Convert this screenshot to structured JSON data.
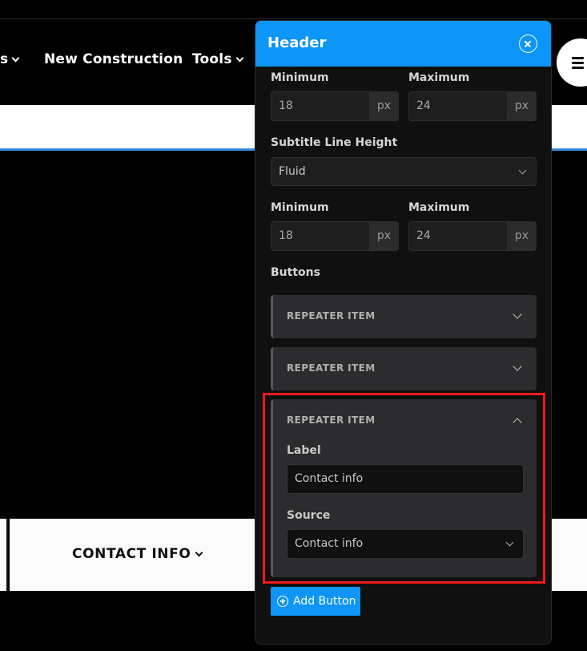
{
  "site": {
    "nav": [
      {
        "label": "s",
        "icon": "chevron-down-icon"
      },
      {
        "label": "New Construction"
      },
      {
        "label": "Tools",
        "icon": "chevron-down-icon"
      }
    ],
    "contact_menu": {
      "label": "CONTACT INFO",
      "icon": "chevron-down-icon"
    },
    "menu_icon": "hamburger-icon"
  },
  "panel": {
    "title": "Header",
    "close_icon": "close-circle-icon",
    "title_font_size": {
      "min_label": "Minimum",
      "min_value": "18",
      "min_unit": "px",
      "max_label": "Maximum",
      "max_value": "24",
      "max_unit": "px"
    },
    "subtitle_line_height": {
      "label": "Subtitle Line Height",
      "selected": "Fluid",
      "min_label": "Minimum",
      "min_value": "18",
      "min_unit": "px",
      "max_label": "Maximum",
      "max_value": "24",
      "max_unit": "px"
    },
    "buttons": {
      "label": "Buttons",
      "items": [
        {
          "title": "REPEATER ITEM",
          "expanded": false
        },
        {
          "title": "REPEATER ITEM",
          "expanded": false
        },
        {
          "title": "REPEATER ITEM",
          "expanded": true,
          "label_field": {
            "label": "Label",
            "value": "Contact info"
          },
          "source_field": {
            "label": "Source",
            "selected": "Contact info"
          }
        }
      ],
      "add_label": "Add Button"
    }
  },
  "colors": {
    "accent": "#0d95f7",
    "highlight": "#ef1a1a",
    "panel_bg": "#101010"
  }
}
